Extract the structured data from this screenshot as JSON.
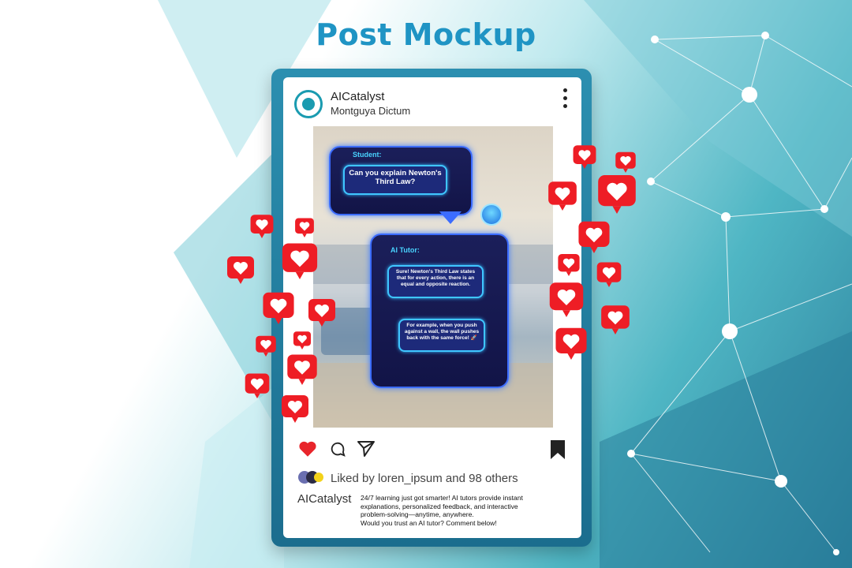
{
  "page_title": "Post Mockup",
  "post": {
    "account_name": "AICatalyst",
    "account_subtitle": "Montguya Dictum",
    "likes_text": "Liked by loren_ipsum and 98 others",
    "caption_user": "AICatalyst",
    "caption_text": "24/7 learning just got smarter! AI tutors provide instant\n explanations, personalized feedback, and interactive\nproblem-solving—anytime, anywhere.\n Would you trust an AI tutor? Comment below!"
  },
  "chat": {
    "student_label": "Student:",
    "student_message": "Can you explain Newton's Third Law?",
    "tutor_label": "AI Tutor:",
    "tutor_message_1": "Sure! Newton's Third Law states that for every action, there is an equal and opposite reaction.",
    "tutor_message_2": "For example, when you push against a wall, the wall pushes back with the same force! 🚀"
  },
  "icons": {
    "like": "heart-icon",
    "comment": "comment-icon",
    "share": "send-icon",
    "save": "bookmark-icon",
    "menu": "more-vertical-icon"
  },
  "colors": {
    "title": "#1f94c4",
    "like": "#e8252b",
    "frame": "#1b6d8e",
    "bubble_border": "#3b6cff"
  }
}
